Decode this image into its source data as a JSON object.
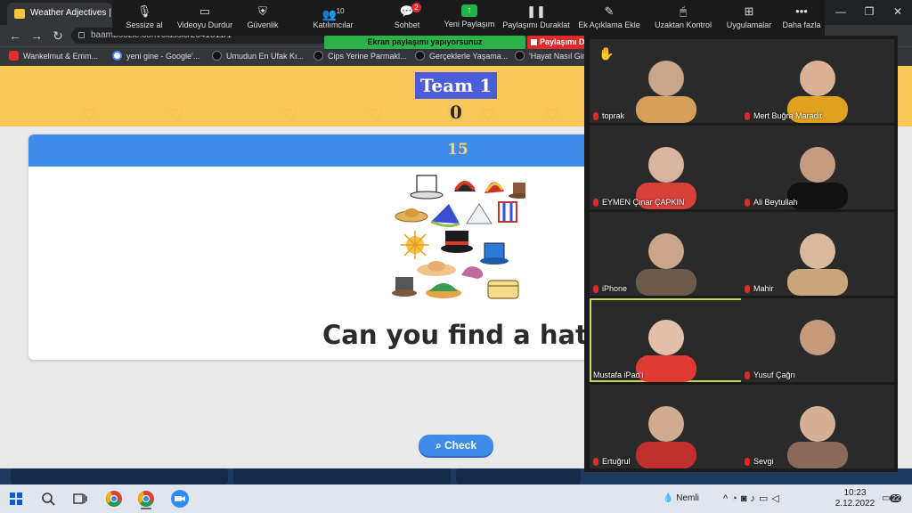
{
  "browser": {
    "tab_title": "Weather Adjectives | B",
    "url": "baamboozle.com/classic/2641511/1",
    "bookmarks": [
      {
        "label": "Wankelmut & Emm...",
        "color": "#e52d27"
      },
      {
        "label": "yeni gine - Google'...",
        "color": "#4285f4"
      },
      {
        "label": "Umudun En Ufak Kı...",
        "color": "#111111"
      },
      {
        "label": "Cips Yerine Parmakl...",
        "color": "#111111"
      },
      {
        "label": "Gerçeklerle Yaşama...",
        "color": "#111111"
      },
      {
        "label": "'Hayat Nasıl Gir...",
        "color": "#111111"
      }
    ],
    "window_controls": [
      "—",
      "❐",
      "✕"
    ]
  },
  "zoom_toolbar": {
    "mute": "Sessize al",
    "stop_video": "Videoyu Durdur",
    "security": "Güvenlik",
    "participants": "Katılımcılar",
    "participants_count": "10",
    "chat": "Sohbet",
    "chat_badge": "2",
    "new_share": "Yeni Paylaşım",
    "pause_share": "Paylaşımı Duraklat",
    "annotate": "Ek Açıklama Ekle",
    "remote_control": "Uzaktan Kontrol",
    "apps": "Uygulamalar",
    "more": "Daha fazla",
    "sharing_banner": "Ekran paylaşımı yapıyorsunuz",
    "stop_share": "Paylaşımı Durdur"
  },
  "game": {
    "team_label": "Team 1",
    "team_score": "0",
    "points": "15",
    "question": "Can you find a hat?",
    "check_button": "Check",
    "brand_color": "#3f8be8",
    "band_color": "#f9c75a"
  },
  "participants": [
    {
      "name": "toprak",
      "skin": "#c9a58a",
      "accent": "#d6a05c"
    },
    {
      "name": "Mert Buğra Maradit",
      "skin": "#d9b295",
      "accent": "#e0a020"
    },
    {
      "name": "EYMEN Çınar ÇAPKIN",
      "skin": "#d7b59e",
      "accent": "#d8403a"
    },
    {
      "name": "Ali Beytullah",
      "skin": "#c49c80",
      "accent": "#111111"
    },
    {
      "name": "iPhone",
      "skin": "#caa589",
      "accent": "#6e5a48"
    },
    {
      "name": "Mahir",
      "skin": "#d9b89e",
      "accent": "#c9a77a"
    },
    {
      "name": "Mustafa iPad'i",
      "skin": "#e2bfa8",
      "accent": "#e03a35"
    },
    {
      "name": "Yusuf Çağrı",
      "skin": "#c69a7c",
      "accent": "#2a2a2a"
    },
    {
      "name": "Ertuğrul",
      "skin": "#d0aa8e",
      "accent": "#c0302c"
    },
    {
      "name": "Sevgi",
      "skin": "#d5b096",
      "accent": "#8a6a58"
    }
  ],
  "taskbar": {
    "weather": "Nemli",
    "time": "10:23",
    "date": "2.12.2022",
    "notifications": "22"
  }
}
